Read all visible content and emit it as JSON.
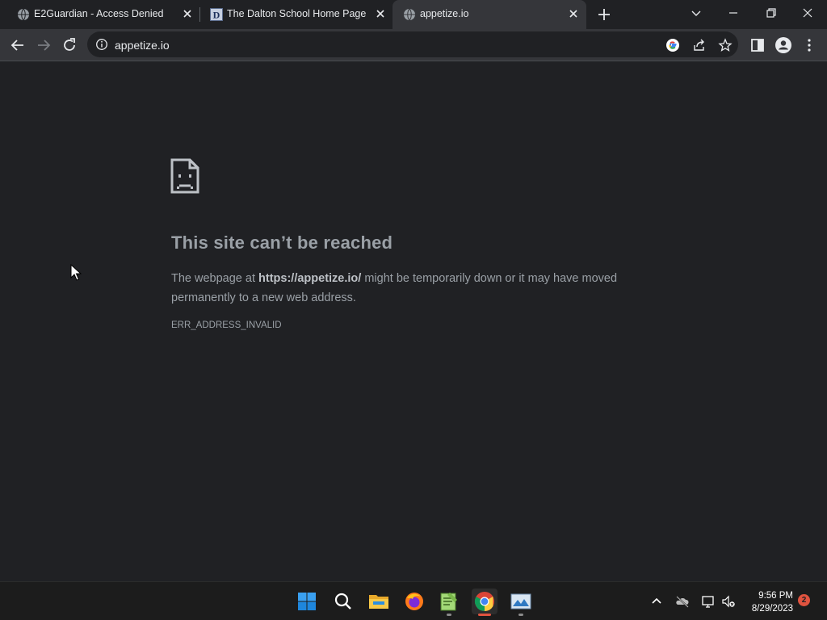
{
  "tabs": [
    {
      "title": "E2Guardian - Access Denied",
      "favicon": "globe-icon",
      "active": false
    },
    {
      "title": "The Dalton School Home Page",
      "favicon": "dalton-d-icon",
      "active": false
    },
    {
      "title": "appetize.io",
      "favicon": "globe-icon",
      "active": true
    }
  ],
  "omnibox": {
    "url": "appetize.io"
  },
  "error_page": {
    "title": "This site can’t be reached",
    "message_prefix": "The webpage at ",
    "message_url": "https://appetize.io/",
    "message_suffix": " might be temporarily down or it may have moved permanently to a new web address.",
    "code": "ERR_ADDRESS_INVALID"
  },
  "taskbar": {
    "apps": [
      "windows-start-icon",
      "search-icon",
      "file-explorer-icon",
      "firefox-icon",
      "notepad-plus-icon",
      "chrome-icon",
      "photos-icon"
    ],
    "clock_time": "9:56 PM",
    "clock_date": "8/29/2023",
    "notification_count": "2"
  },
  "colors": {
    "page_bg": "#202124",
    "toolbar_bg": "#35363a",
    "accent_red": "#e0533f"
  }
}
